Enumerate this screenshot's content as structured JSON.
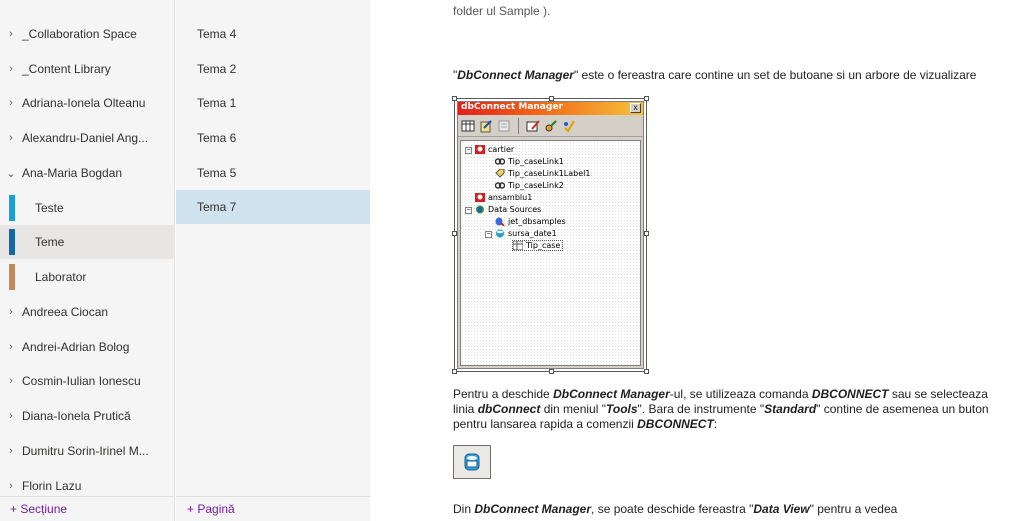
{
  "sections": {
    "items": [
      {
        "label": "_Collaboration Space",
        "chevron": "›"
      },
      {
        "label": "_Content Library",
        "chevron": "›"
      },
      {
        "label": "Adriana-Ionela Olteanu",
        "chevron": "›"
      },
      {
        "label": "Alexandru-Daniel Ang...",
        "chevron": "›"
      },
      {
        "label": "Ana-Maria Bogdan",
        "chevron": "⌄"
      },
      {
        "label": "Teste",
        "color": "#1aa0d8"
      },
      {
        "label": "Teme",
        "color": "#1565a8"
      },
      {
        "label": "Laborator",
        "color": "#c08a5a"
      },
      {
        "label": "Andreea Ciocan",
        "chevron": "›"
      },
      {
        "label": "Andrei-Adrian Bolog",
        "chevron": "›"
      },
      {
        "label": "Cosmin-Iulian Ionescu",
        "chevron": "›"
      },
      {
        "label": "Diana-Ionela Prutică",
        "chevron": "›"
      },
      {
        "label": "Dumitru Sorin-Irinel M...",
        "chevron": "›"
      },
      {
        "label": "Florin Lazu",
        "chevron": "›"
      }
    ],
    "add_label": "+ Secțiune"
  },
  "pages": {
    "items": [
      "Tema 4",
      "Tema 2",
      "Tema 1",
      "Tema 6",
      "Tema 5",
      "Tema 7"
    ],
    "selected": "Tema 7",
    "add_label": "+ Pagină"
  },
  "content": {
    "top_partial": "folder ul Sample ).",
    "para1_q1": "\"",
    "para1_b1": "DbConnect Manager",
    "para1_rest": "\" este o fereastra care contine un set de butoane si un arbore de vizualizare",
    "dbwin": {
      "title": "dbConnect Manager",
      "close": "x",
      "tree": [
        "cartier",
        "Tip_caseLink1",
        "Tip_caseLink1Label1",
        "Tip_caseLink2",
        "ansamblu1",
        "Data Sources",
        "jet_dbsamples",
        "sursa_date1",
        "Tip_case"
      ]
    },
    "para2": {
      "a": "Pentru a deschide ",
      "b": "DbConnect Manager",
      "c": "-ul, se utilizeaza comanda ",
      "d": "DBCONNECT",
      "e": " sau se selecteaza linia ",
      "f": "dbConnect",
      "g": " din meniul \"",
      "h": "Tools",
      "i": "\". Bara de instrumente \"",
      "j": "Standard",
      "k": "\" contine de asemenea un buton pentru lansarea rapida a comenzii ",
      "l": "DBCONNECT",
      "m": ":"
    },
    "para3": {
      "a": "Din ",
      "b": "DbConnect Manager",
      "c": ", se poate deschide fereastra \"",
      "d": "Data View",
      "e": "\" pentru a vedea"
    }
  },
  "colors": {
    "selected_page": "#cfe2ee",
    "accent": "#7719aa"
  }
}
